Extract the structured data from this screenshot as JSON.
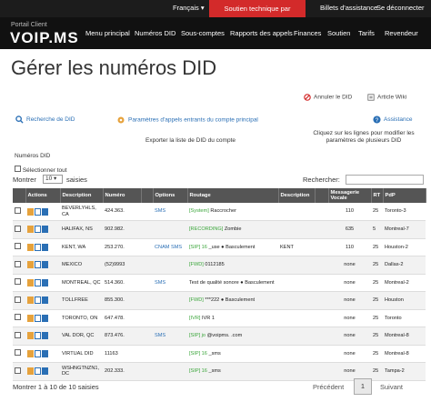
{
  "topbar": {
    "language": "Français ▾",
    "support": "Soutien technique par clavardage",
    "tickets": "Billets d'assistance",
    "logout": "Se déconnecter"
  },
  "logo": {
    "sub": "Portail Client",
    "name": "VOIP.MS"
  },
  "nav": [
    "Menu principal",
    "Numéros DID",
    "Sous-comptes",
    "Rapports des appels",
    "Finances",
    "Soutien",
    "Tarifs",
    "Revendeur"
  ],
  "page": {
    "title": "Gérer les numéros DID",
    "cancel_did": "Annuler le DID",
    "wiki": "Article Wiki",
    "search_did": "Recherche de DID",
    "incoming_settings": "Paramètres d'appels entrants du compte principal",
    "assistance": "Assistance",
    "export": "Exporter la liste de DID du compte",
    "multi_hint": "Cliquez sur les lignes pour modifier les paramètres de plusieurs DID",
    "did_numbers_label": "Numéros DID",
    "select_all": "Sélectionner tout",
    "show": "Montrer",
    "entries_value": "10",
    "entries_suffix": "saisies",
    "search_label": "Rechercher:",
    "footer_info": "Montrer 1 à 10 de 10 saisies",
    "prev": "Précédent",
    "page_num": "1",
    "next": "Suivant"
  },
  "table": {
    "headers": [
      "",
      "Actions",
      "Description",
      "Numéro",
      "",
      "Options",
      "Routage",
      "Description",
      "",
      "Messagerie Vocale",
      "RT",
      "PdP"
    ],
    "rows": [
      {
        "desc": "BEVERLYHLS, CA",
        "num": "424.363.",
        "opt": "SMS",
        "route_tag": "[System]",
        "route": "Raccrocher",
        "desc2": "",
        "vm": "110",
        "rt": "25",
        "pop": "Toronto-3"
      },
      {
        "desc": "HALIFAX, NS",
        "num": "902.982.",
        "opt": "",
        "route_tag": "[RECORDING]",
        "route": "Zombie",
        "desc2": "",
        "vm": "635",
        "rt": "5",
        "pop": "Montreal-7"
      },
      {
        "desc": "KENT, WA",
        "num": "253.270.",
        "opt": "CNAM SMS",
        "route_tag": "[SIP] 16",
        "route": "_use ● Basculement",
        "desc2": "KENT",
        "vm": "110",
        "rt": "25",
        "pop": "Houston-2"
      },
      {
        "desc": "MEXICO",
        "num": "(52)9993",
        "opt": "",
        "route_tag": "[FWD]",
        "route": "0112185",
        "desc2": "",
        "vm": "none",
        "rt": "25",
        "pop": "Dallas-2"
      },
      {
        "desc": "MONTREAL, QC",
        "num": "514.360.",
        "opt": "SMS",
        "route_tag": "",
        "route": "Test de qualité sonore ● Basculement",
        "desc2": "",
        "vm": "none",
        "rt": "25",
        "pop": "Montreal-2"
      },
      {
        "desc": "TOLLFREE",
        "num": "855.300.",
        "opt": "",
        "route_tag": "[FWD]",
        "route": "***222 ● Basculement",
        "desc2": "",
        "vm": "none",
        "rt": "25",
        "pop": "Houston"
      },
      {
        "desc": "TORONTO, ON",
        "num": "647.478.",
        "opt": "",
        "route_tag": "[IVR]",
        "route": "IVR 1",
        "desc2": "",
        "vm": "none",
        "rt": "25",
        "pop": "Toronto"
      },
      {
        "desc": "VAL DOR, QC",
        "num": "873.476.",
        "opt": "SMS",
        "route_tag": "[SIP] jo",
        "route": "@voipms. .com",
        "desc2": "",
        "vm": "none",
        "rt": "25",
        "pop": "Montreal-8"
      },
      {
        "desc": "VIRTUAL DID",
        "num": "11163",
        "opt": "",
        "route_tag": "[SIP] 16",
        "route": "_sms",
        "desc2": "",
        "vm": "none",
        "rt": "25",
        "pop": "Montreal-8"
      },
      {
        "desc": "WSHNGTNZN1, DC",
        "num": "202.333.",
        "opt": "",
        "route_tag": "[SIP] 16",
        "route": "_sms",
        "desc2": "",
        "vm": "none",
        "rt": "25",
        "pop": "Tampa-2"
      }
    ]
  },
  "colors": {
    "support_red": "#d32a2a",
    "nav_bg": "#111111",
    "header_bg": "#555555",
    "tag_green": "#3aa53a",
    "link_blue": "#2a6fb5"
  }
}
